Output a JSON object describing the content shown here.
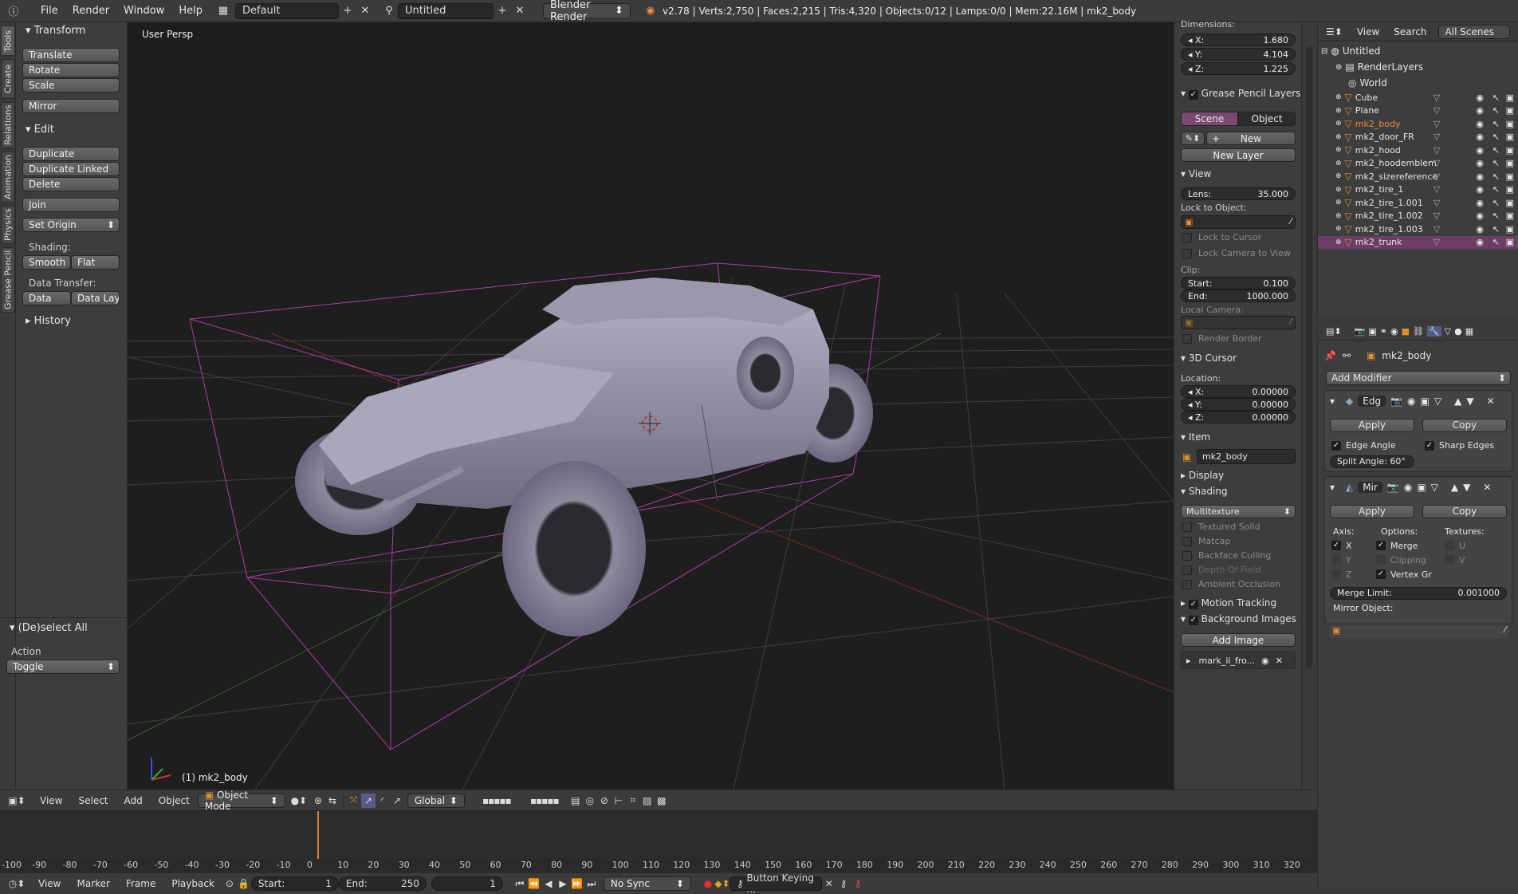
{
  "topbar": {
    "menus": [
      "File",
      "Render",
      "Window",
      "Help"
    ],
    "layout": "Default",
    "scene": "Untitled",
    "engine": "Blender Render",
    "stats": "v2.78 | Verts:2,750 | Faces:2,215 | Tris:4,320 | Objects:0/12 | Lamps:0/0 | Mem:22.16M | mk2_body"
  },
  "left_tabs": [
    "Tools",
    "Create",
    "Relations",
    "Animation",
    "Physics",
    "Grease Pencil"
  ],
  "tools": {
    "transform_head": "Transform",
    "translate": "Translate",
    "rotate": "Rotate",
    "scale": "Scale",
    "mirror": "Mirror",
    "edit_head": "Edit",
    "duplicate": "Duplicate",
    "duplicate_linked": "Duplicate Linked",
    "delete": "Delete",
    "join": "Join",
    "set_origin": "Set Origin",
    "shading_label": "Shading:",
    "smooth": "Smooth",
    "flat": "Flat",
    "data_transfer_label": "Data Transfer:",
    "data": "Data",
    "data_layo": "Data Layo",
    "history": "History"
  },
  "operator": {
    "title": "(De)select All",
    "action_label": "Action",
    "action_value": "Toggle"
  },
  "viewport": {
    "view_label": "User Persp",
    "object_label": "(1) mk2_body"
  },
  "npanel": {
    "dimensions_label": "Dimensions:",
    "dim_x": "1.680",
    "dim_y": "4.104",
    "dim_z": "1.225",
    "grease_pencil_layers": "Grease Pencil Layers",
    "scene_tab": "Scene",
    "object_tab": "Object",
    "new_btn": "New",
    "new_layer": "New Layer",
    "view_head": "View",
    "lens_label": "Lens:",
    "lens_value": "35.000",
    "lock_to_object": "Lock to Object:",
    "lock_to_cursor": "Lock to Cursor",
    "lock_camera": "Lock Camera to View",
    "clip_label": "Clip:",
    "clip_start_label": "Start:",
    "clip_start": "0.100",
    "clip_end_label": "End:",
    "clip_end": "1000.000",
    "local_camera": "Local Camera:",
    "render_border": "Render Border",
    "cursor_head": "3D Cursor",
    "location_label": "Location:",
    "cur_x": "0.00000",
    "cur_y": "0.00000",
    "cur_z": "0.00000",
    "item_head": "Item",
    "item_name": "mk2_body",
    "display_head": "Display",
    "shading_head": "Shading",
    "shading_mode": "Multitexture",
    "textured_solid": "Textured Solid",
    "matcap": "Matcap",
    "backface_culling": "Backface Culling",
    "depth_of_field": "Depth Of Field",
    "ambient_occlusion": "Ambient Occlusion",
    "motion_tracking": "Motion Tracking",
    "background_images": "Background Images",
    "add_image": "Add Image",
    "bg_image_name": "mark_ii_fro..."
  },
  "outliner": {
    "view": "View",
    "search": "Search",
    "filter": "All Scenes",
    "root": "Untitled",
    "renderlayers": "RenderLayers",
    "world": "World",
    "objects": [
      {
        "name": "Cube",
        "color": "#e6e6e6"
      },
      {
        "name": "Plane",
        "color": "#e6e6e6"
      },
      {
        "name": "mk2_body",
        "color": "#f08a3c"
      },
      {
        "name": "mk2_door_FR",
        "color": "#e6e6e6"
      },
      {
        "name": "mk2_hood",
        "color": "#e6e6e6"
      },
      {
        "name": "mk2_hoodemblem",
        "color": "#e6e6e6"
      },
      {
        "name": "mk2_sizereference",
        "color": "#e6e6e6"
      },
      {
        "name": "mk2_tire_1",
        "color": "#e6e6e6"
      },
      {
        "name": "mk2_tire_1.001",
        "color": "#e6e6e6"
      },
      {
        "name": "mk2_tire_1.002",
        "color": "#e6e6e6"
      },
      {
        "name": "mk2_tire_1.003",
        "color": "#e6e6e6"
      },
      {
        "name": "mk2_trunk",
        "color": "#e6e6e6"
      }
    ]
  },
  "props": {
    "object_name": "mk2_body",
    "add_modifier": "Add Modifier",
    "mod1_name": "Edg",
    "apply": "Apply",
    "copy": "Copy",
    "edge_angle": "Edge Angle",
    "sharp_edges": "Sharp Edges",
    "split_angle": "Split Angle: 60°",
    "mod2_name": "Mir",
    "axis_label": "Axis:",
    "options_label": "Options:",
    "textures_label": "Textures:",
    "x": "X",
    "y": "Y",
    "z": "Z",
    "merge": "Merge",
    "clipping": "Clipping",
    "vertex_gr": "Vertex Gr",
    "u": "U",
    "v": "V",
    "merge_limit_label": "Merge Limit:",
    "merge_limit": "0.001000",
    "mirror_object": "Mirror Object:"
  },
  "view3d_header": {
    "view": "View",
    "select": "Select",
    "add": "Add",
    "object": "Object",
    "mode": "Object Mode",
    "orientation": "Global"
  },
  "timeline": {
    "ticks": [
      "-100",
      "-90",
      "-80",
      "-70",
      "-60",
      "-50",
      "-40",
      "-30",
      "-20",
      "-10",
      "0",
      "10",
      "20",
      "30",
      "40",
      "50",
      "60",
      "70",
      "80",
      "90",
      "100",
      "110",
      "120",
      "130",
      "140",
      "150",
      "160",
      "170",
      "180",
      "190",
      "200",
      "210",
      "220",
      "230",
      "240",
      "250",
      "260",
      "270",
      "280",
      "290",
      "300",
      "310",
      "320"
    ],
    "current_frame": 1
  },
  "timeline_header": {
    "view": "View",
    "marker": "Marker",
    "frame": "Frame",
    "playback": "Playback",
    "start_label": "Start:",
    "start": "1",
    "end_label": "End:",
    "end": "250",
    "current": "1",
    "sync": "No Sync",
    "keying": "Button Keying ..."
  },
  "colors": {
    "accent_active": "#7a4a72",
    "selected_row": "#6e3d66",
    "orange_selected": "#f08a3c",
    "playhead": "#e07830"
  }
}
